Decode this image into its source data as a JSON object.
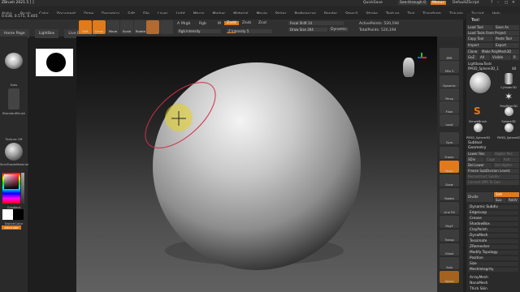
{
  "window": {
    "title": "ZBrush 2021.5 [ ]",
    "quicksave": "QuickSave",
    "see_through": "See-through 0",
    "menus_label": "Menus",
    "script_label": "DefaultZScript"
  },
  "menubar": [
    "Alpha",
    "Brush",
    "Color",
    "Document",
    "Draw",
    "Dynamics",
    "Edit",
    "File",
    "Layer",
    "Light",
    "Macro",
    "Marker",
    "Material",
    "Movie",
    "Picker",
    "Preferences",
    "Render",
    "Stencil",
    "Stroke",
    "Texture",
    "Tool",
    "Transform",
    "Zplugin",
    "Zscript",
    "Help"
  ],
  "coords_text": "0.038, 0.575, 0.405",
  "tabs": [
    "Home Page",
    "LightBox",
    "Live Boolean"
  ],
  "shelf": {
    "edit": "Edit",
    "draw": "Draw",
    "move": "Move",
    "scale": "Scale",
    "rotate": "Rotate",
    "mrgb": "Mrgb",
    "rgb": "Rgb",
    "m": "M",
    "zadd": "Zadd",
    "zsub": "Zsub",
    "zcut": "Zcut",
    "rgb_intensity": "Rgb Intensity",
    "z_intensity": "Z Intensity 5",
    "focal_shift": "Focal Shift 14",
    "draw_size": "Draw Size 264",
    "dynamic": "Dynamic",
    "active_points": "ActivePoints: 520,194",
    "total_points": "TotalPoints: 520,194"
  },
  "left_tray": [
    "23",
    "Dots",
    "StandardBrush",
    "Texture Off",
    "SkinShadeMaterial",
    "Gradient",
    "SwitchColor",
    "Alternate"
  ],
  "right_tools": [
    "BPR",
    "SPix 3",
    "Dynamic",
    "Persp",
    "Floor",
    "Local",
    "Gyro",
    "Frame",
    "Move",
    "Scale",
    "Rotate",
    "Line Fill",
    "PolyF",
    "Transp",
    "Ghost",
    "Solo",
    "Xpose"
  ],
  "tool_panel": {
    "header": "Tool",
    "load_tool": "Load Tool",
    "save_as": "Save As",
    "load_project": "Load Tools From Project",
    "copy_tool": "Copy Tool",
    "paste_tool": "Paste Tool",
    "import": "Import",
    "export": "Export",
    "clone": "Clone",
    "make_polymesh": "Make PolyMesh3D",
    "goz": "GoZ",
    "all": "All",
    "visible": "Visible",
    "r": "R",
    "lightbox_tools": "Lightbox▸Tools",
    "current_tool": "PM3D_Sphere3D_1",
    "current_count": "48",
    "subtools": [
      "Cylinder3D",
      "PolyMesh3D",
      "SimpleBrush",
      "Sphere3D",
      "PM3D_Sphere3D",
      "PM3D_Sphere3D_1"
    ],
    "subtool_label": "Subtool",
    "geometry_label": "Geometry",
    "lower_res": "Lower Res",
    "higher_res": "Higher Res",
    "sdiv": "SDiv",
    "cage": "Cage",
    "rstr": "Rstr",
    "del_lower": "Del Lower",
    "del_higher": "Del Higher",
    "freeze_subdiv": "Freeze SubDivision Levels",
    "reconstruct": "Reconstruct Subdiv",
    "convert_bpr": "Convert BPR To Geo",
    "divide": "Divide",
    "smt": "Smt",
    "suv": "Suv",
    "reuv": "ReUV",
    "items": [
      "Dynamic Subdiv",
      "EdgeLoop",
      "Crease",
      "ShadowBox",
      "ClayPolish",
      "DynaMesh",
      "Tessimate",
      "ZRemesher",
      "Modify Topology",
      "Position",
      "Size",
      "MeshIntegrity"
    ],
    "bottom_items": [
      "ArrayMesh",
      "NanoMesh",
      "Thick Skin"
    ]
  },
  "colors": {
    "accent": "#e07a1a",
    "canvas_top": "#0a0a0a",
    "canvas_bottom": "#616161",
    "brush_ring": "#d0304a",
    "cursor": "#e6d21f"
  }
}
